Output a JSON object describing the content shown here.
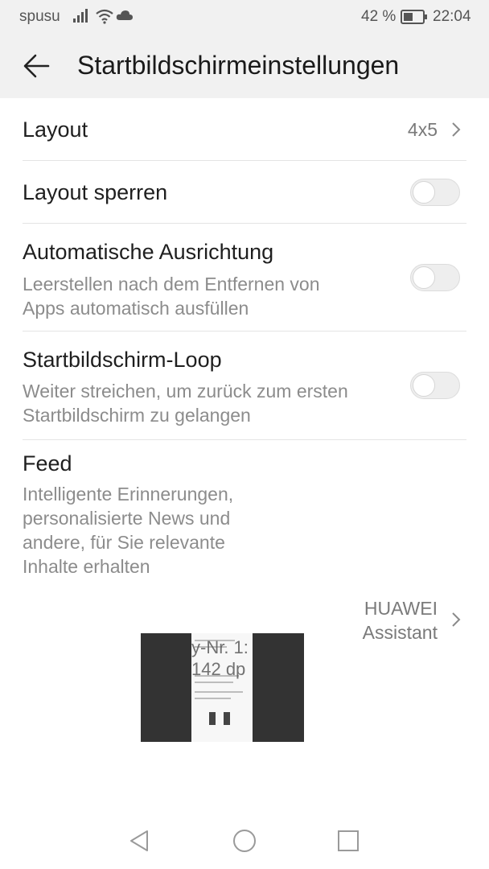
{
  "status_bar": {
    "carrier": "spusu",
    "battery_percent": "42 %",
    "time": "22:04",
    "icons": [
      "signal-icon",
      "wifi-icon",
      "cloud-icon",
      "battery-icon"
    ]
  },
  "app_bar": {
    "title": "Startbildschirmeinstellungen",
    "back_icon": "arrow-left-icon"
  },
  "settings": {
    "layout": {
      "title": "Layout",
      "value": "4x5"
    },
    "lock_layout": {
      "title": "Layout sperren",
      "enabled": false
    },
    "auto_align": {
      "title": "Automatische Ausrichtung",
      "subtitle_line1": "Leerstellen nach dem Entfernen von",
      "subtitle_line2": "Apps automatisch ausfüllen",
      "enabled": false
    },
    "loop": {
      "title": "Startbildschirm-Loop",
      "subtitle_line1": "Weiter streichen, um zurück zum ersten",
      "subtitle_line2": "Startbildschirm zu gelangen",
      "enabled": false
    },
    "feed": {
      "title": "Feed",
      "subtitle_line1": "Intelligente Erinnerungen,",
      "subtitle_line2": "personalisierte News und",
      "subtitle_line3": "andere, für Sie relevante",
      "subtitle_line4": "Inhalte erhalten",
      "value_line1": "HUAWEI",
      "value_line2": "Assistant"
    }
  },
  "preview_overlay": {
    "line1": "y-Nr. 1:",
    "line2": "142 dp"
  },
  "nav_bar": {
    "icons": [
      "back-triangle-icon",
      "home-circle-icon",
      "recents-square-icon"
    ]
  },
  "colors": {
    "bar_background": "#f1f1f1",
    "primary_text": "#1f1f1f",
    "secondary_text": "#8c8c8c",
    "toggle_off": "#eeeeee"
  }
}
